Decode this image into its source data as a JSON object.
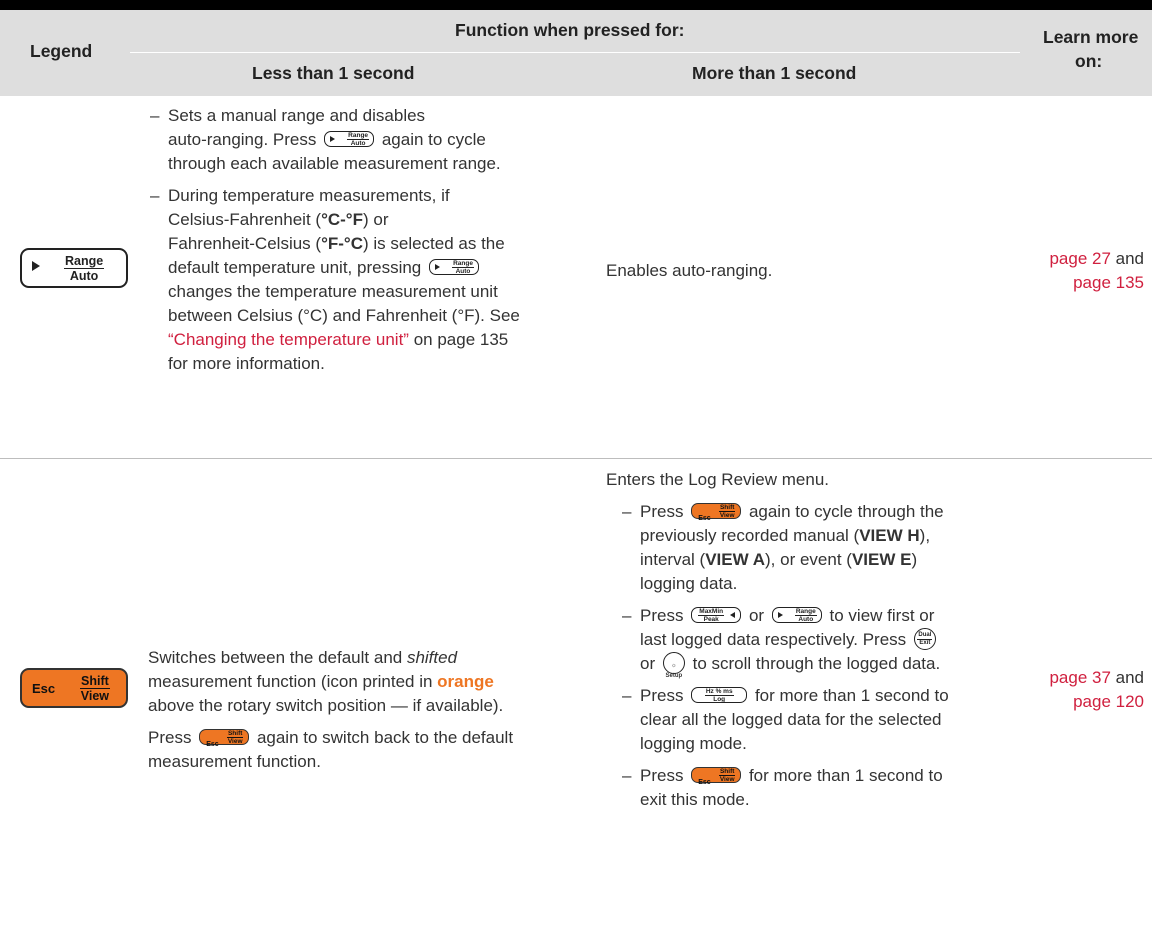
{
  "header": {
    "legend": "Legend",
    "function_title": "Function when pressed for:",
    "less": "Less than 1 second",
    "more": "More than 1 second",
    "learn": "Learn more",
    "learn2": "on:"
  },
  "keys": {
    "range_top": "Range",
    "range_bottom": "Auto",
    "esc": "Esc",
    "shift_top": "Shift",
    "shift_bottom": "View",
    "maxmin_top": "MaxMin",
    "maxmin_bottom": "Peak",
    "hz_top": "Hz % ms",
    "hz_bottom": "Log",
    "dual_top": "Dual",
    "dual_bottom": "Exit",
    "setup_bottom": "Setup"
  },
  "row1": {
    "b1a": "Sets a manual range and disables",
    "b1b": "auto-ranging. Press",
    "b1c": "again to cycle",
    "b1d": "through each available measurement range.",
    "b2a": "During temperature measurements, if",
    "b2b": "Celsius-Fahrenheit (",
    "b2b_bold": "°C-°F",
    "b2b_end": ") or",
    "b2c": "Fahrenheit-Celsius (",
    "b2c_bold": "°F-°C",
    "b2c_end": ") is selected as the",
    "b2d": "default temperature unit, pressing",
    "b2e": "changes the temperature measurement unit",
    "b2f": "between Celsius (°C) and Fahrenheit (°F). See",
    "b2g_link": "“Changing the temperature unit”",
    "b2g_end": " on page 135",
    "b2h": "for more information.",
    "more_text": "Enables auto-ranging.",
    "learn_link1": "page 27",
    "learn_and": " and",
    "learn_link2": "page 135"
  },
  "row2": {
    "less_a": "Switches between the default and ",
    "less_a_it": "shifted",
    "less_b": "measurement function (icon printed in ",
    "less_b_bold": "orange",
    "less_c": "above the rotary switch position — if available).",
    "less_d": "Press",
    "less_d_end": "again to switch back to the default",
    "less_e": "measurement function.",
    "more_intro": "Enters the Log Review menu.",
    "m1a": "Press",
    "m1a_end": "again to cycle through the",
    "m1b": "previously recorded manual (",
    "m1b_bold": "VIEW H",
    "m1b_end": "),",
    "m1c": "interval (",
    "m1c_bold": "VIEW A",
    "m1c_mid": "), or event (",
    "m1c_bold2": "VIEW E",
    "m1c_end": ")",
    "m1d": "logging data.",
    "m2a": "Press",
    "m2a_or": "or",
    "m2a_end": "to view first or",
    "m2b": "last logged data respectively. Press",
    "m2c": "or",
    "m2c_end": "to scroll through the logged data.",
    "m3a": "Press",
    "m3a_end": "for more than 1 second to",
    "m3b": "clear all the logged data for the selected",
    "m3c": "logging mode.",
    "m4a": "Press",
    "m4a_end": "for more than 1 second to",
    "m4b": "exit this mode.",
    "learn_link1": "page 37",
    "learn_and": " and",
    "learn_link2": "page 120"
  }
}
